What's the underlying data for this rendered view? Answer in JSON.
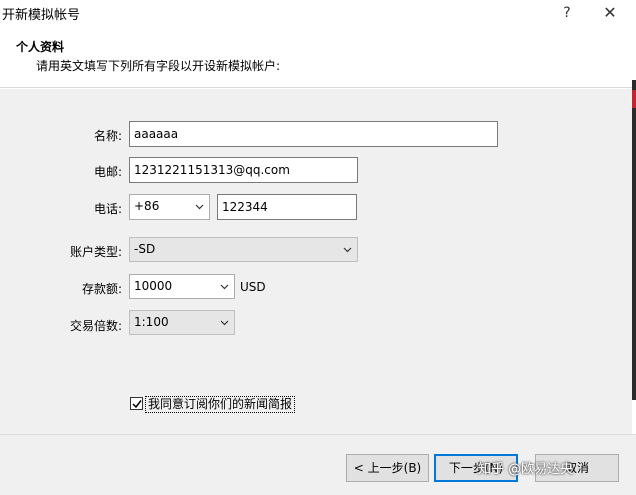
{
  "window": {
    "title": "开新模拟帐号",
    "help_label": "?",
    "close_label": "✕"
  },
  "header": {
    "title": "个人资料",
    "subtitle": "请用英文填写下列所有字段以开设新模拟帐户:"
  },
  "form": {
    "name": {
      "label": "名称:",
      "value": "aaaaaa"
    },
    "email": {
      "label": "电邮:",
      "value": "1231221151313@qq.com"
    },
    "phone": {
      "label": "电话:",
      "country_code": "+86",
      "value": "122344"
    },
    "account_type": {
      "label": "账户类型:",
      "value": "-SD",
      "disabled": true
    },
    "deposit": {
      "label": "存款额:",
      "value": "10000",
      "currency": "USD"
    },
    "leverage": {
      "label": "交易倍数:",
      "value": "1:100",
      "disabled": true
    },
    "newsletter": {
      "label": "我同意订阅你们的新闻简报",
      "checked": true
    }
  },
  "footer": {
    "back_label": "< 上一步(B)",
    "next_label": "下一步(N)",
    "cancel_label": "取消"
  },
  "watermark": "知乎 @欧易达央",
  "colors": {
    "accent": "#0078d7",
    "panel": "#f0f0f0",
    "strip_red": "#c0262d"
  }
}
